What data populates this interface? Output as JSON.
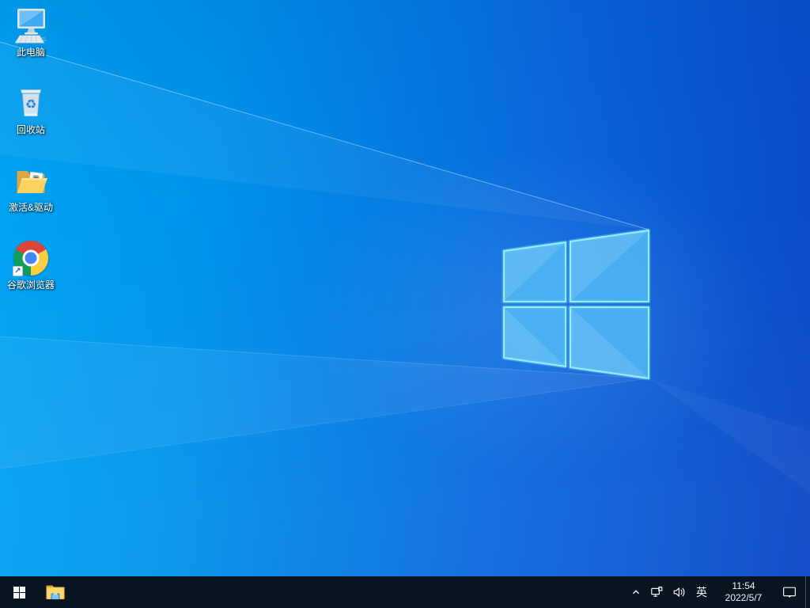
{
  "desktop": {
    "icons": [
      {
        "name": "this-pc",
        "label": "此电脑"
      },
      {
        "name": "recycle-bin",
        "label": "回收站"
      },
      {
        "name": "activation-drivers",
        "label": "激活&驱动"
      },
      {
        "name": "google-chrome",
        "label": "谷歌浏览器"
      }
    ],
    "wallpaper": {
      "theme": "windows-10-light-logo",
      "gradient_left": "#00a5f3",
      "gradient_right": "#0a46c6",
      "logo_edge_glow": "#86efff",
      "logo_pane_fill": "#34b0f2"
    }
  },
  "taskbar": {
    "background": "#081520",
    "tray": {
      "ime": "英",
      "time": "11:54",
      "date": "2022/5/7"
    },
    "chrome_colors": {
      "red": "#db4437",
      "yellow": "#ffcd40",
      "green": "#0f9d58",
      "blue": "#4285f4"
    }
  }
}
